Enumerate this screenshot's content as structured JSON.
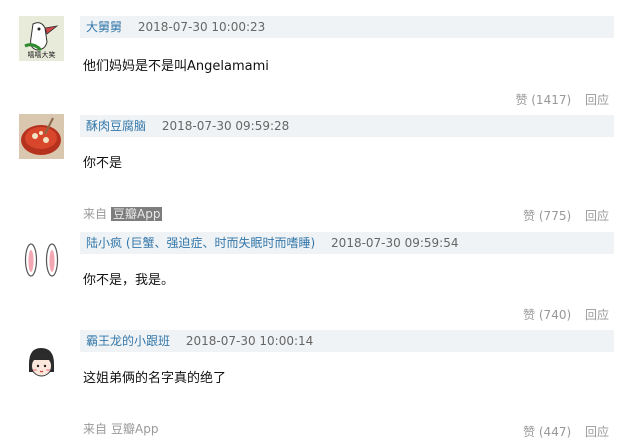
{
  "comments": [
    {
      "author": "大舅舅",
      "badge": "",
      "time": "2018-07-30 10:00:23",
      "text": "他们妈妈是不是叫Angelamami",
      "avatar_text": "嘻嘻大笑",
      "from_label": "",
      "from_app": "",
      "likes": "赞 (1417)",
      "reply": "回应"
    },
    {
      "author": "酥肉豆腐脑",
      "badge": "",
      "time": "2018-07-30 09:59:28",
      "text": "你不是",
      "from_label": "来自",
      "from_app": "豆瓣App",
      "likes": "赞 (775)",
      "reply": "回应"
    },
    {
      "author": "陆小疯",
      "badge": "(巨蟹、强迫症、时而失眠时而嗜睡)",
      "time": "2018-07-30 09:59:54",
      "text": "你不是，我是。",
      "from_label": "",
      "from_app": "",
      "likes": "赞 (740)",
      "reply": "回应"
    },
    {
      "author": "霸王龙的小跟班",
      "badge": "",
      "time": "2018-07-30 10:00:14",
      "text": "这姐弟俩的名字真的绝了",
      "from_label": "来自",
      "from_app": "豆瓣App",
      "likes": "赞 (447)",
      "reply": "回应"
    }
  ],
  "colors": {
    "link": "#3377aa",
    "header_bg": "#f0f3f5",
    "meta": "#999999"
  },
  "icons": [
    "bird-avatar-icon",
    "food-bowl-avatar-icon",
    "rabbit-ears-avatar-icon",
    "girl-face-avatar-icon"
  ]
}
